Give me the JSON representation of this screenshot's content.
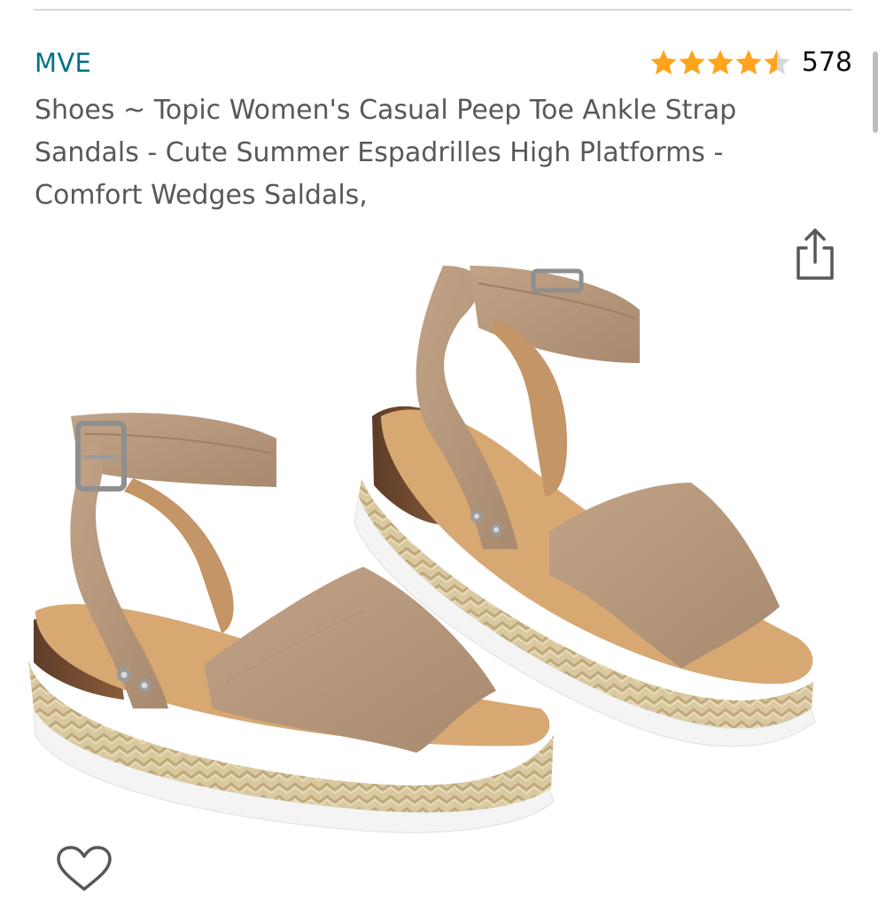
{
  "product": {
    "brand": "MVE",
    "rating": {
      "stars": 4.5,
      "max_stars": 5,
      "count": "578",
      "star_color": "#ffa41c",
      "empty_star_color": "#d5d9d9"
    },
    "title": "Shoes ~ Topic Women's Casual Peep Toe Ankle Strap Sandals - Cute Summer Espadrilles High Platforms - Comfort Wedges Saldals,"
  },
  "icons": {
    "share": "share-icon",
    "wishlist": "heart-outline-icon"
  },
  "colors": {
    "brand_link": "#007185",
    "title_text": "#565959",
    "icon_gray": "#565959"
  }
}
